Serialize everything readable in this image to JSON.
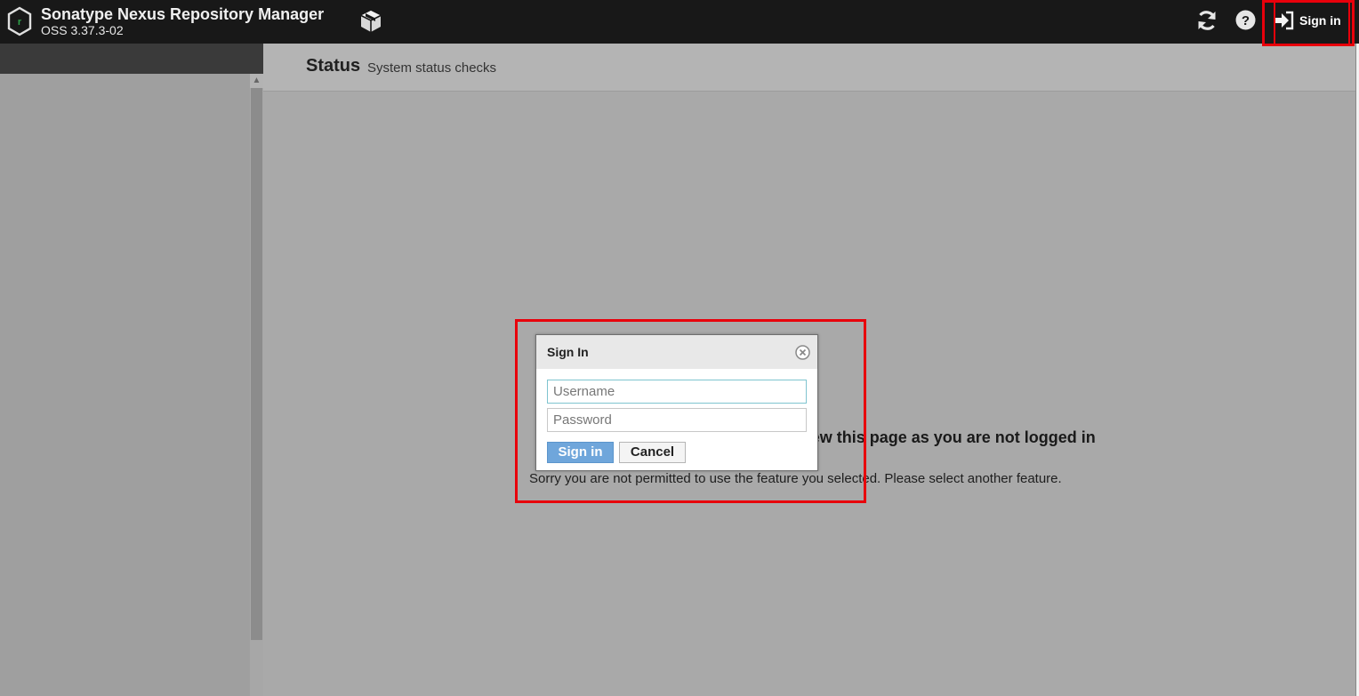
{
  "header": {
    "app_title": "Sonatype Nexus Repository Manager",
    "app_version": "OSS 3.37.3-02",
    "signin_label": "Sign in",
    "icons": {
      "logo": "nexus-logo-hexagon",
      "browse": "cube-icon",
      "refresh": "refresh-icon",
      "help": "help-icon",
      "signin": "sign-in-icon"
    },
    "background": "#181818"
  },
  "main": {
    "title": "Status",
    "subtitle": "System status checks",
    "denied_title": "You do not have permission to view this page as you are not logged in",
    "denied_text": "Sorry you are not permitted to use the feature you selected. Please select another feature."
  },
  "dialog": {
    "title": "Sign In",
    "username_placeholder": "Username",
    "username_value": "",
    "password_placeholder": "Password",
    "password_value": "",
    "signin_label": "Sign in",
    "cancel_label": "Cancel",
    "close_icon": "close-circle-icon"
  },
  "colors": {
    "highlight": "#e8000b",
    "primary_button": "#6fa6db",
    "overlay": "#a9a9a9"
  }
}
